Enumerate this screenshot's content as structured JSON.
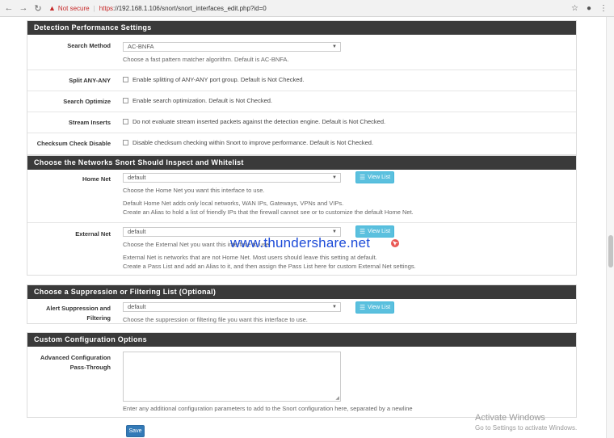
{
  "browser": {
    "not_secure": "Not secure",
    "url_scheme": "https",
    "url_rest": "://192.168.1.106/snort/snort_interfaces_edit.php?id=0"
  },
  "panels": {
    "detection": {
      "title": "Detection Performance Settings",
      "search_method": {
        "label": "Search Method",
        "value": "AC-BNFA",
        "help": "Choose a fast pattern matcher algorithm. Default is AC-BNFA."
      },
      "split_any": {
        "label": "Split ANY-ANY",
        "text": "Enable splitting of ANY-ANY port group. Default is Not Checked."
      },
      "search_optimize": {
        "label": "Search Optimize",
        "text": "Enable search optimization. Default is Not Checked."
      },
      "stream_inserts": {
        "label": "Stream Inserts",
        "text": "Do not evaluate stream inserted packets against the detection engine. Default is Not Checked."
      },
      "checksum": {
        "label": "Checksum Check Disable",
        "text": "Disable checksum checking within Snort to improve performance. Default is Not Checked."
      }
    },
    "networks": {
      "title": "Choose the Networks Snort Should Inspect and Whitelist",
      "home_net": {
        "label": "Home Net",
        "value": "default",
        "button": "View List",
        "help1": "Choose the Home Net you want this interface to use.",
        "help2": "Default Home Net adds only local networks, WAN IPs, Gateways, VPNs and VIPs.",
        "help3": "Create an Alias to hold a list of friendly IPs that the firewall cannot see or to customize the default Home Net."
      },
      "external_net": {
        "label": "External Net",
        "value": "default",
        "button": "View List",
        "help1": "Choose the External Net you want this interface to use.",
        "help2": "External Net is networks that are not Home Net. Most users should leave this setting at default.",
        "help3": "Create a Pass List and add an Alias to it, and then assign the Pass List here for custom External Net settings."
      }
    },
    "suppression": {
      "title": "Choose a Suppression or Filtering List (Optional)",
      "alert": {
        "label_line1": "Alert Suppression and",
        "label_line2": "Filtering",
        "value": "default",
        "button": "View List",
        "help": "Choose the suppression or filtering file you want this interface to use."
      }
    },
    "custom": {
      "title": "Custom Configuration Options",
      "advanced": {
        "label_line1": "Advanced Configuration",
        "label_line2": "Pass-Through",
        "help": "Enter any additional configuration parameters to add to the Snort configuration here, separated by a newline"
      }
    }
  },
  "save_label": "Save",
  "watermark": "www.thundershare.net",
  "activate": {
    "title": "Activate Windows",
    "subtitle": "Go to Settings to activate Windows."
  },
  "colors": {
    "panel_header": "#3a3a3a",
    "info_button": "#5bc0de",
    "primary_button": "#337ab7",
    "not_secure": "#c62828"
  }
}
